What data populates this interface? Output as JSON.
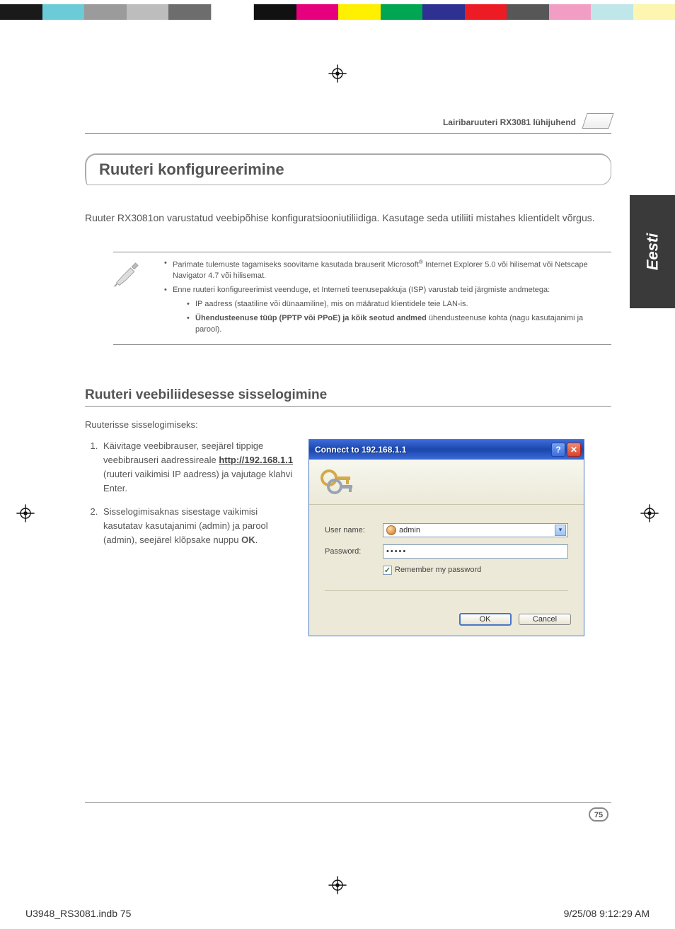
{
  "header": {
    "doc_title": "Lairibaruuteri RX3081 lühijuhend"
  },
  "lang_tab": "Eesti",
  "title": "Ruuteri konfigureerimine",
  "intro": "Ruuter RX3081on varustatud veebipõhise konfiguratsiooniutiliidiga. Kasutage seda utiliiti mistahes klientidelt võrgus.",
  "note": {
    "b1a": "Parimate tulemuste tagamiseks soovitame kasutada brauserit Microsoft",
    "reg": "®",
    "b1b": "  Internet Explorer 5.0 või hilisemat või Netscape Navigator 4.7 või hilisemat.",
    "b2": "Enne ruuteri konfigureerimist veenduge, et Interneti teenusepakkuja (ISP) varustab teid järgmiste andmetega:",
    "s1": "IP aadress (staatiline või dünaamiline), mis on määratud klientidele teie LAN-is.",
    "s2_bold": "Ühendusteenuse tüüp (PPTP või PPoE) ja kõik seotud andmed",
    "s2_rest": " ühendusteenuse kohta (nagu kasutajanimi ja parool)."
  },
  "section2": "Ruuteri veebiliidesesse sisselogimine",
  "sub": "Ruuterisse sisselogimiseks:",
  "steps": {
    "s1a": "Käivitage veebibrauser, seejärel tippige veebibrauseri aadressireale ",
    "s1_link": "http://192.168.1.1",
    "s1b": " (ruuteri vaikimisi IP aadress) ja vajutage klahvi Enter.",
    "s2a": "Sisselogimisaknas sisestage vaikimisi kasutatav kasutajanimi (admin) ja parool (admin), seejärel klõpsake nuppu ",
    "s2_bold": "OK",
    "s2b": "."
  },
  "dialog": {
    "title": "Connect to 192.168.1.1",
    "user_label": "User name:",
    "user_value": "admin",
    "pass_label": "Password:",
    "pass_value": "•••••",
    "remember": "Remember my password",
    "ok": "OK",
    "cancel": "Cancel"
  },
  "page_number": "75",
  "imprint": {
    "left": "U3948_RS3081.indb   75",
    "right": "9/25/08   9:12:29 AM"
  }
}
